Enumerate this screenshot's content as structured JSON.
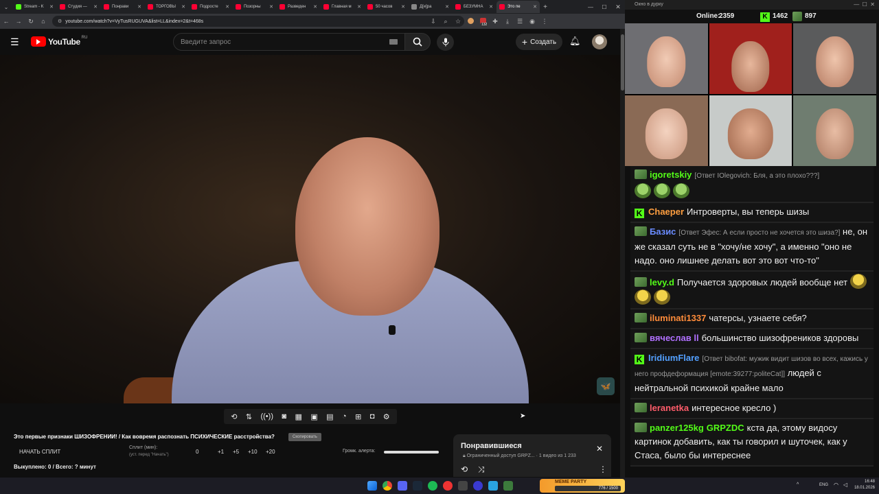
{
  "browser": {
    "tabs": [
      {
        "label": "Stream - K",
        "color": "#53fc18"
      },
      {
        "label": "Студия —",
        "color": "#ff0033"
      },
      {
        "label": "Понрави",
        "color": "#ff0033"
      },
      {
        "label": "ТОРГОВЫ",
        "color": "#ff0033"
      },
      {
        "label": "Подросте",
        "color": "#ff0033"
      },
      {
        "label": "Позорны",
        "color": "#ff0033"
      },
      {
        "label": "Разведен",
        "color": "#ff0033"
      },
      {
        "label": "Главная м",
        "color": "#ff0033"
      },
      {
        "label": "50 часов",
        "color": "#ff0033"
      },
      {
        "label": "Д[и]ра",
        "color": "#888888"
      },
      {
        "label": "БЕЗУМНА",
        "color": "#ff0033"
      },
      {
        "label": "Это пе",
        "color": "#ff0033"
      }
    ],
    "url": "youtube.com/watch?v=VyTusRUGUVA&list=LL&index=2&t=468s",
    "new_tab": "+",
    "ext_count": "132"
  },
  "youtube": {
    "logo_text": "YouTube",
    "logo_region": "RU",
    "search_placeholder": "Введите запрос",
    "create_label": "Создать"
  },
  "extension": {
    "video_title": "Это первые признаки ШИЗОФРЕНИИ! / Как вовремя распознать ПСИХИЧЕСКИЕ расстройства?",
    "copy_label": "Скопировать",
    "start_split": "НАЧАТЬ СПЛИТ",
    "split_label": "Сплит (мин):",
    "split_hint": "(уст. перед \"Начать\")",
    "split_value": "0",
    "increments": [
      "+1",
      "+5",
      "+10",
      "+20"
    ],
    "volume_label": "Громк. алерта:",
    "bought": "Выкуплено: 0 / Всего: ? минут"
  },
  "playlist": {
    "title": "Понравившиеся",
    "access": "Ограниченный доступ",
    "owner": "GRPZ...",
    "position": "· 1 видео из 1 233"
  },
  "stream": {
    "window_title": "Окно в дурку",
    "online_label": "Online:",
    "online_count": "2359",
    "kick_count": "1462",
    "other_count": "897"
  },
  "chat": [
    {
      "nick": "igoretskiy",
      "color": "#53fc18",
      "reply": "[Ответ IOlegovich: Бля, а это плохо???]",
      "text": "",
      "emotes": 3,
      "emote_style": "green",
      "badge": "pepe"
    },
    {
      "nick": "Chaeper",
      "color": "#ff9f40",
      "reply": "",
      "text": "Интроверты, вы теперь шизы",
      "emotes": 0,
      "badge": "kick"
    },
    {
      "nick": "Базис",
      "color": "#6a8cff",
      "reply": "[Ответ Эфес: А если просто не хочется это шиза?]",
      "text": "не, он же сказал суть не в \"хочу/не хочу\", а именно \"оно не надо. оно лишнее делать вот это вот что-то\"",
      "emotes": 0,
      "badge": "pepe"
    },
    {
      "nick": "levy.d",
      "color": "#53fc18",
      "reply": "",
      "text": "Получается здоровых людей вообще нет",
      "emotes": 3,
      "emote_style": "yellow",
      "badge": "pepe"
    },
    {
      "nick": "iluminati1337",
      "color": "#ff8c3a",
      "reply": "",
      "text": "чатерсы, узнаете себя?",
      "emotes": 0,
      "badge": "pepe"
    },
    {
      "nick": "вячеслав ll",
      "color": "#b070ff",
      "reply": "",
      "text": "большинство шизофреников здоровы",
      "emotes": 0,
      "badge": "pepe"
    },
    {
      "nick": "IridiumFlare",
      "color": "#53a0ff",
      "reply": "[Ответ bibofat: мужик видит шизов во всех, кажись у него профдеформация [emote:39277:politeCat]]",
      "text": "людей с нейтральной психикой крайне мало",
      "emotes": 0,
      "badge": "kick"
    },
    {
      "nick": "leranetka",
      "color": "#ff5c6a",
      "reply": "",
      "text": "интересное кресло )",
      "emotes": 0,
      "badge": "pepe"
    },
    {
      "nick": "panzer125kg",
      "color": "#53fc18",
      "extra": "GRPZDC",
      "reply": "",
      "text": "кста да, этому видосу картинок добавить, как ты говорил и шуточек, как у Стаса, было бы интереснее",
      "emotes": 0,
      "badge": "pepe"
    }
  ],
  "taskbar": {
    "lang": "ENG",
    "time": "16:48",
    "date": "18.01.2026",
    "meme_label": "MEME PARTY",
    "meme_progress": "776 / 1500"
  }
}
